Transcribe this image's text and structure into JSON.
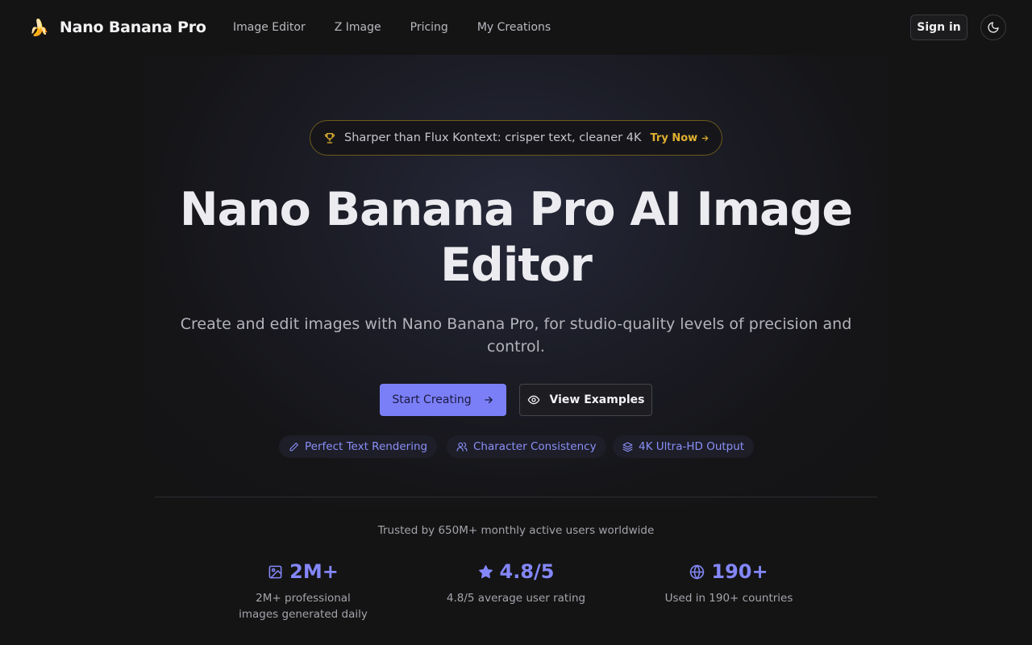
{
  "nav": {
    "brand_logo": "🍌",
    "brand_name": "Nano Banana Pro",
    "links": [
      "Image Editor",
      "Z Image",
      "Pricing",
      "My Creations"
    ],
    "signin_label": "Sign in",
    "theme_icon": "moon-icon"
  },
  "announcement": {
    "icon": "trophy-icon",
    "text": "Sharper than Flux Kontext: crisper text, cleaner 4K",
    "cta": "Try Now"
  },
  "hero": {
    "title": "Nano Banana Pro AI Image Editor",
    "subtitle": "Create and edit images with Nano Banana Pro, for studio-quality levels of precision and control.",
    "primary_cta": "Start Creating",
    "secondary_cta": "View Examples"
  },
  "features": [
    {
      "label": "Perfect Text Rendering",
      "icon": "pencil-icon"
    },
    {
      "label": "Character Consistency",
      "icon": "users-icon"
    },
    {
      "label": "4K Ultra-HD Output",
      "icon": "layers-icon"
    }
  ],
  "trusted_text": "Trusted by 650M+ monthly active users worldwide",
  "stats": [
    {
      "value": "2M+",
      "desc": "2M+ professional images generated daily",
      "icon": "image-icon"
    },
    {
      "value": "4.8/5",
      "desc": "4.8/5 average user rating",
      "icon": "star-icon"
    },
    {
      "value": "190+",
      "desc": "Used in 190+ countries",
      "icon": "globe-icon"
    }
  ],
  "colors": {
    "background": "#141414",
    "accent": "#7b7ff7",
    "accent_text": "#8387f8",
    "gold": "#e0b030"
  }
}
